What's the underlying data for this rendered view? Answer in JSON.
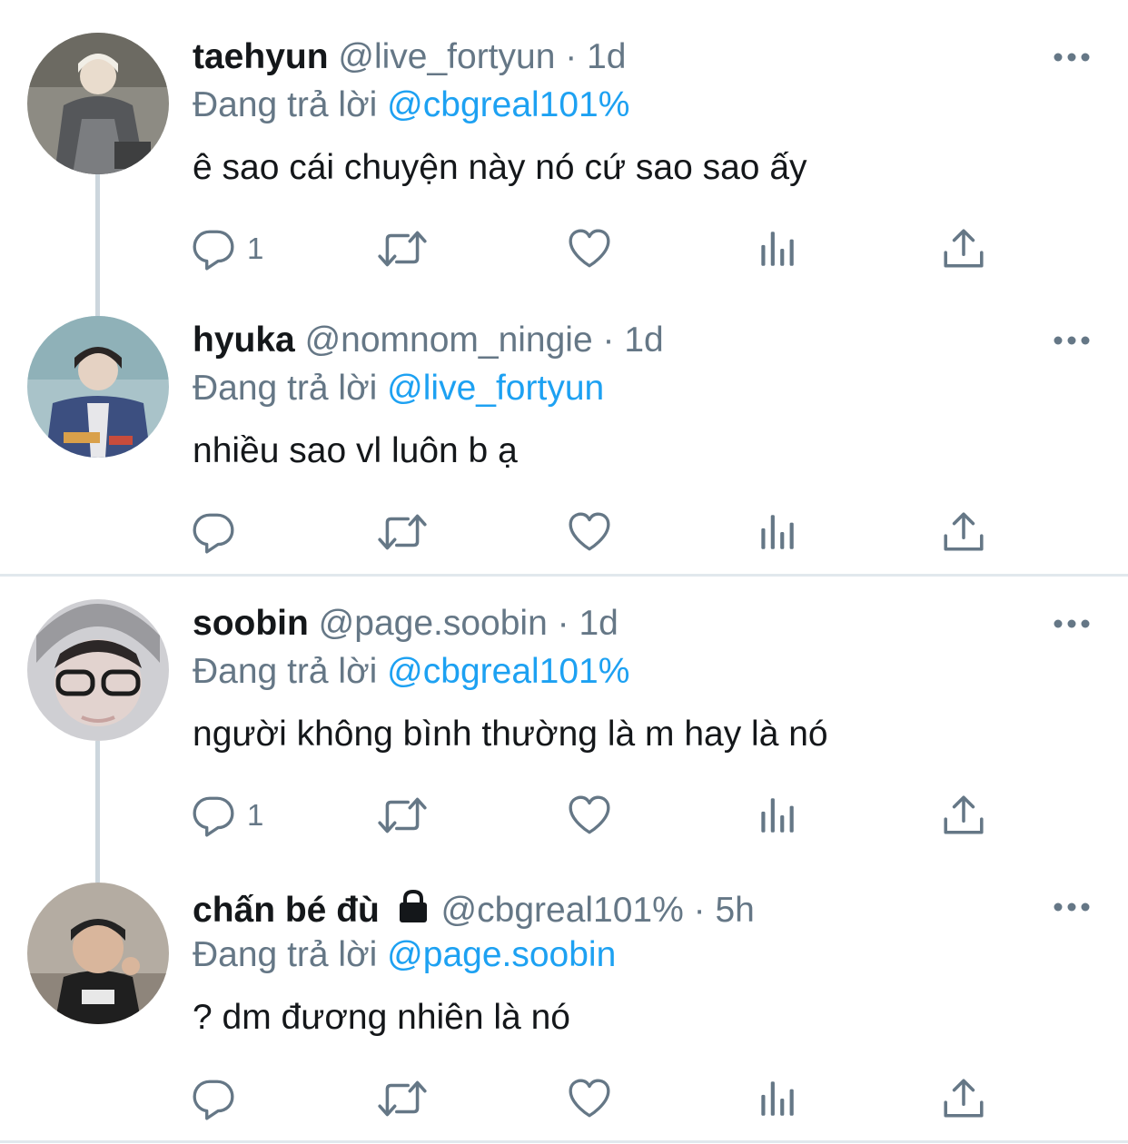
{
  "colors": {
    "text": "#14171a",
    "secondary": "#657786",
    "link": "#1da1f2",
    "thread_line": "#ccd6dd",
    "divider": "#e1e8ed"
  },
  "icons": {
    "reply": "reply-icon",
    "retweet": "retweet-icon",
    "like": "like-icon",
    "stats": "stats-icon",
    "share": "share-icon",
    "more": "more-icon",
    "lock": "lock-icon"
  },
  "tweets": [
    {
      "name": "taehyun",
      "handle": "@live_fortyun",
      "dot": "·",
      "time": "1d",
      "replying_prefix": "Đang trả lời",
      "replying_to": "@cbgreal101%",
      "text": "ê sao cái chuyện này nó cứ sao sao ấy",
      "reply_count": "1"
    },
    {
      "name": "hyuka",
      "handle": "@nomnom_ningie",
      "dot": "·",
      "time": "1d",
      "replying_prefix": "Đang trả lời",
      "replying_to": "@live_fortyun",
      "text": "nhiều sao vl luôn b ạ",
      "reply_count": ""
    },
    {
      "name": "soobin",
      "handle": "@page.soobin",
      "dot": "·",
      "time": "1d",
      "replying_prefix": "Đang trả lời",
      "replying_to": "@cbgreal101%",
      "text": "người không bình thường là m hay là nó",
      "reply_count": "1"
    },
    {
      "name": "chấn bé đù",
      "handle": "@cbgreal101%",
      "dot": "·",
      "time": "5h",
      "replying_prefix": "Đang trả lời",
      "replying_to": "@page.soobin",
      "text": "? dm đương nhiên là nó",
      "reply_count": ""
    }
  ]
}
